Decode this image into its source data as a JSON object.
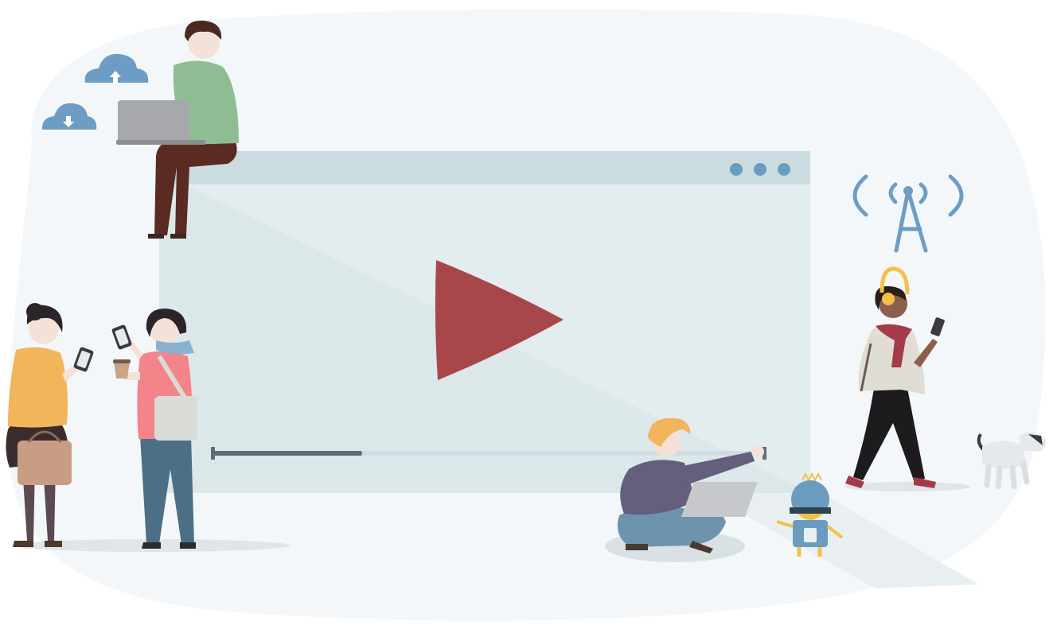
{
  "illustration": {
    "subject": "online-video-streaming",
    "player": {
      "window_dots_count": 3,
      "playback_progress": 0.27
    },
    "colors": {
      "backdrop_blob": "#f4f7f9",
      "player_frame": "#cfdee2",
      "player_screen": "#e1ebee",
      "play_button": "#a8474a",
      "progress_track": "#cfdde2",
      "progress_fill": "#5e6e75",
      "window_dots": "#6b9bbf",
      "cloud": "#6d9dc5",
      "signal_tower": "#6d9dc5",
      "robot_body": "#6b9bbf",
      "robot_face": "#f3c14a"
    },
    "icons": [
      "cloud-upload-icon",
      "cloud-download-icon",
      "play-icon",
      "window-dots-icon",
      "signal-tower-icon"
    ],
    "figures": [
      "man-with-laptop-on-player",
      "woman-with-phone-and-bag",
      "woman-with-coffee-and-phone",
      "man-sitting-with-laptop",
      "robot",
      "woman-with-headphones-walking",
      "robot-dog"
    ]
  }
}
